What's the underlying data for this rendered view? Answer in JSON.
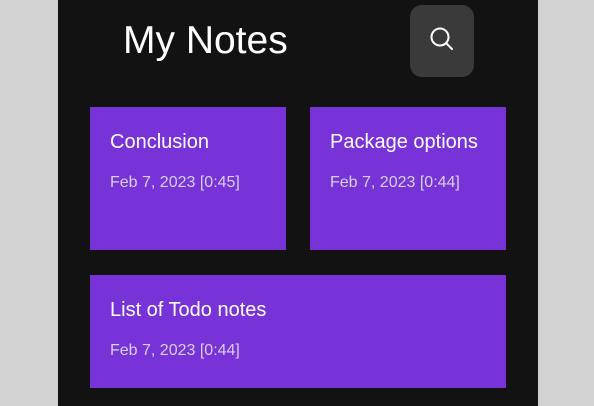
{
  "header": {
    "title": "My Notes",
    "search_icon": "search-icon"
  },
  "colors": {
    "background": "#121212",
    "note_card": "#7732d8",
    "search_button": "#3a3a3a"
  },
  "notes": [
    {
      "title": "Conclusion",
      "date": "Feb 7, 2023 [0:45]"
    },
    {
      "title": "Package options",
      "date": "Feb 7, 2023 [0:44]"
    },
    {
      "title": "List of Todo notes",
      "date": "Feb 7, 2023 [0:44]"
    }
  ]
}
